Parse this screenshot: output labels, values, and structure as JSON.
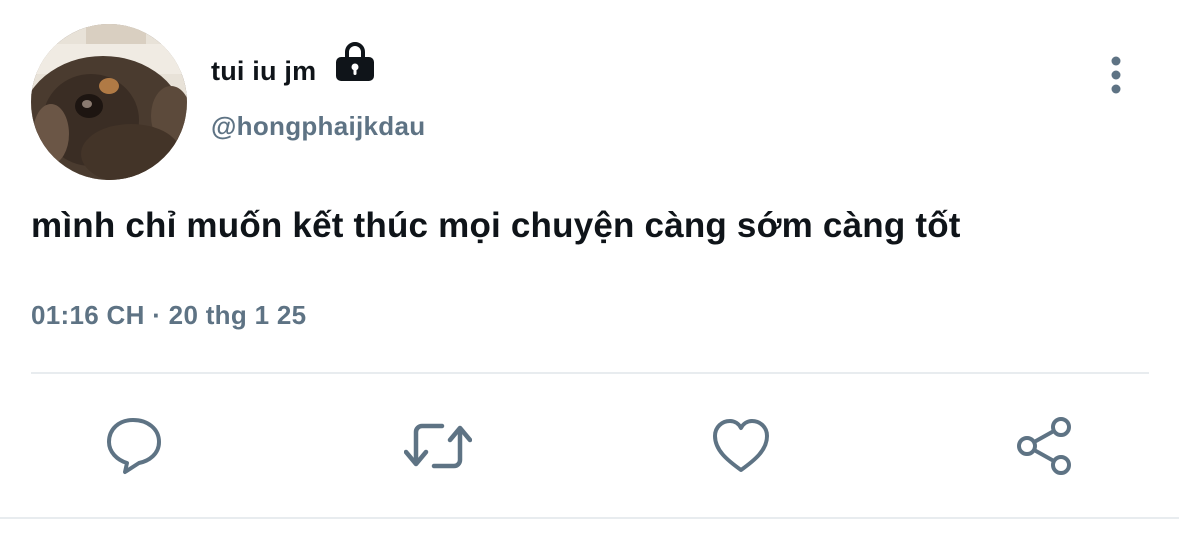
{
  "profile": {
    "display_name": "tui iu jm",
    "handle": "@hongphaijkdau",
    "avatar_icon": "dog-photo-avatar",
    "protected_icon": "lock-icon"
  },
  "tweet": {
    "text": "mình chỉ muốn kết thúc mọi chuyện càng sớm càng tốt",
    "timestamp": "01:16 CH · 20 thg 1 25"
  },
  "actions": {
    "reply_icon": "reply-icon",
    "retweet_icon": "retweet-icon",
    "like_icon": "heart-icon",
    "share_icon": "share-icon",
    "more_icon": "more-vertical-icon"
  },
  "colors": {
    "text_primary": "#0f1419",
    "text_secondary": "#5e7384",
    "icon": "#5e7384",
    "divider": "#e8ecef"
  }
}
